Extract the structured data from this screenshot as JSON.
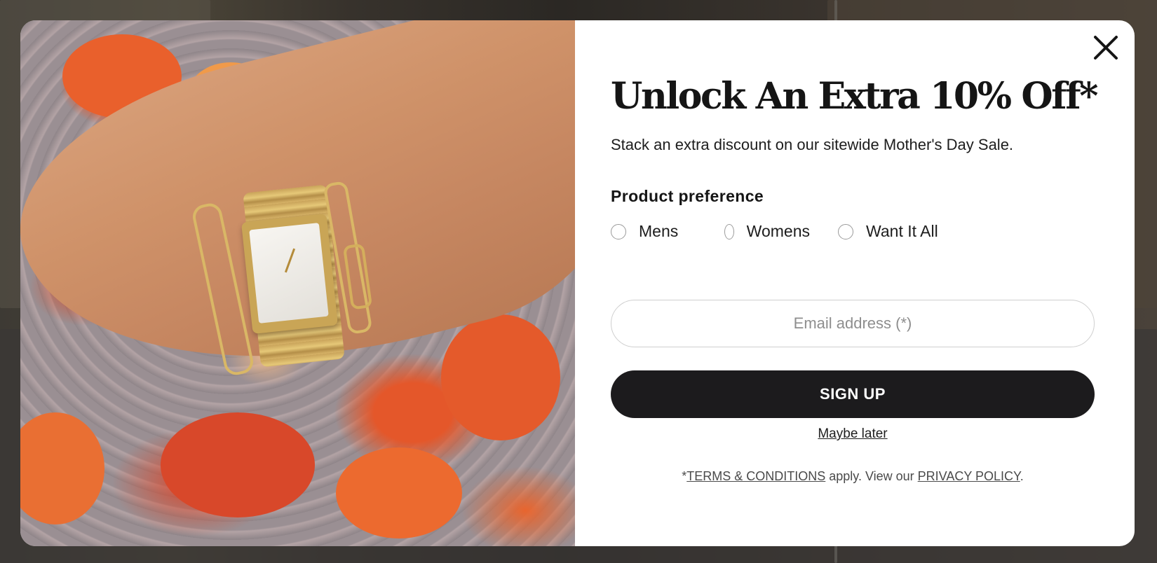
{
  "modal": {
    "headline": "Unlock An Extra 10% Off*",
    "subheadline": "Stack an extra discount on our sitewide Mother's Day Sale.",
    "close_icon": "close-icon",
    "product_preference": {
      "label": "Product preference",
      "options": [
        "Mens",
        "Womens",
        "Want It All"
      ],
      "selected": null
    },
    "email": {
      "placeholder": "Email address (*)",
      "value": ""
    },
    "signup_label": "SIGN UP",
    "maybe_later_label": "Maybe later",
    "legal": {
      "prefix": "*",
      "terms_label": "TERMS & CONDITIONS",
      "middle": " apply. View our ",
      "privacy_label": "PRIVACY POLICY",
      "suffix": "."
    },
    "colors": {
      "button_bg": "#1c1b1d",
      "button_text": "#ffffff",
      "panel_bg": "#ffffff",
      "text": "#151515"
    }
  }
}
